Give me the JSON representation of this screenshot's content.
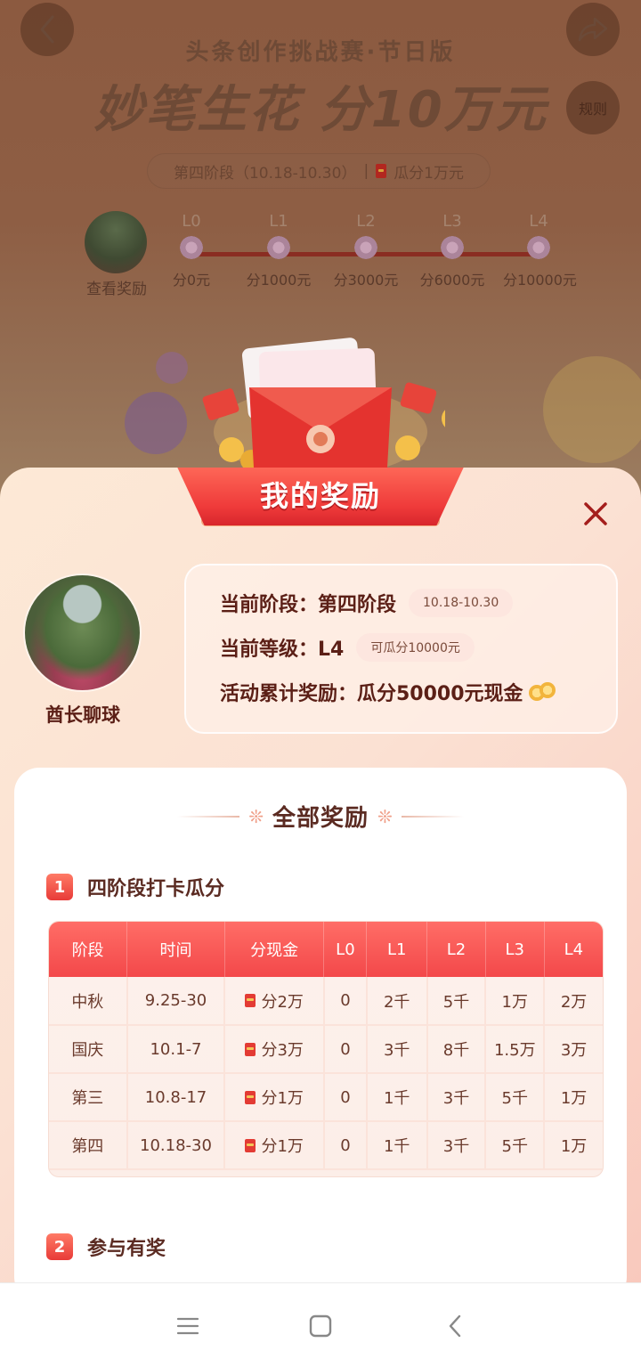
{
  "header": {
    "subtitle": "头条创作挑战赛·节日版",
    "title": "妙笔生花 分10万元",
    "stage_pill": "第四阶段（10.18-10.30）",
    "stage_pill_divider": "|",
    "stage_pill_reward": "瓜分1万元",
    "rules_label": "规则",
    "view_rewards_label": "查看奖励"
  },
  "levels": [
    {
      "code": "L0",
      "amount": "分0元"
    },
    {
      "code": "L1",
      "amount": "分1000元"
    },
    {
      "code": "L2",
      "amount": "分3000元"
    },
    {
      "code": "L3",
      "amount": "分6000元"
    },
    {
      "code": "L4",
      "amount": "分10000元"
    }
  ],
  "sheet": {
    "banner_title": "我的奖励",
    "user_name": "酋长聊球",
    "stage_label": "当前阶段：第四阶段",
    "stage_dates": "10.18-10.30",
    "level_label": "当前等级：L4",
    "level_chip": "可瓜分10000元",
    "cumulative_label": "活动累计奖励：瓜分50000元现金"
  },
  "rewards": {
    "heading": "全部奖励",
    "section1": {
      "num": "1",
      "title": "四阶段打卡瓜分"
    },
    "section2": {
      "num": "2",
      "title": "参与有奖"
    },
    "table": {
      "headers": [
        "阶段",
        "时间",
        "分现金",
        "L0",
        "L1",
        "L2",
        "L3",
        "L4"
      ],
      "rows": [
        [
          "中秋",
          "9.25-30",
          "分2万",
          "0",
          "2千",
          "5千",
          "1万",
          "2万"
        ],
        [
          "国庆",
          "10.1-7",
          "分3万",
          "0",
          "3千",
          "8千",
          "1.5万",
          "3万"
        ],
        [
          "第三",
          "10.8-17",
          "分1万",
          "0",
          "1千",
          "3千",
          "5千",
          "1万"
        ],
        [
          "第四",
          "10.18-30",
          "分1万",
          "0",
          "1千",
          "3千",
          "5千",
          "1万"
        ]
      ]
    }
  },
  "colors": {
    "accent_red": "#f3484a",
    "panel_peach": "#fde9d6",
    "text_dark": "#5b1f16"
  },
  "icons": [
    "back-arrow-icon",
    "share-icon",
    "red-packet-icon",
    "flower-icon",
    "close-icon",
    "coin-icon",
    "menu-icon",
    "home-icon",
    "nav-back-icon"
  ]
}
